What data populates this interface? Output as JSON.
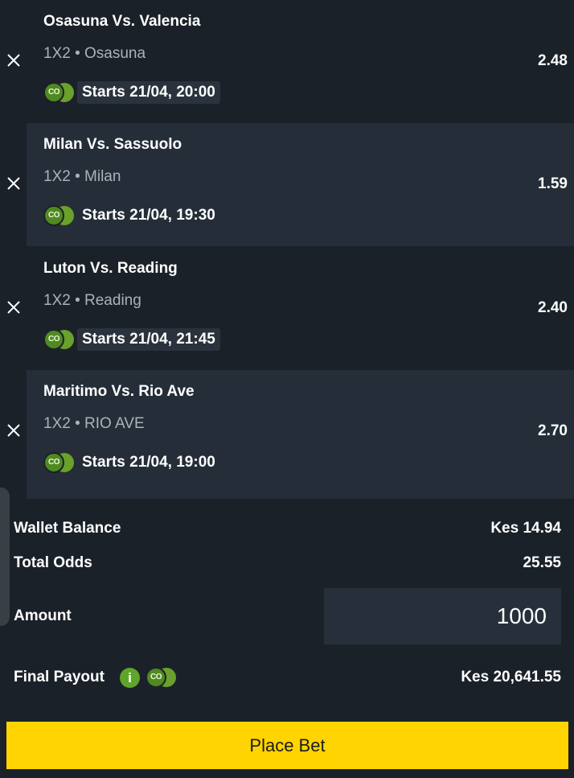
{
  "bets": [
    {
      "match": "Osasuna Vs. Valencia",
      "market": "1X2 • Osasuna",
      "odds": "2.48",
      "starts": "Starts 21/04, 20:00"
    },
    {
      "match": "Milan Vs. Sassuolo",
      "market": "1X2 • Milan",
      "odds": "1.59",
      "starts": "Starts 21/04, 19:30"
    },
    {
      "match": "Luton Vs. Reading",
      "market": "1X2 • Reading",
      "odds": "2.40",
      "starts": "Starts 21/04, 21:45"
    },
    {
      "match": "Maritimo Vs. Rio Ave",
      "market": "1X2 • RIO AVE",
      "odds": "2.70",
      "starts": "Starts 21/04, 19:00"
    }
  ],
  "coin_icon_text": "CO",
  "summary": {
    "wallet_label": "Wallet Balance",
    "wallet_value": "Kes 14.94",
    "odds_label": "Total Odds",
    "odds_value": "25.55",
    "amount_label": "Amount",
    "amount_value": "1000",
    "payout_label": "Final Payout",
    "info_glyph": "i",
    "payout_value": "Kes 20,641.55"
  },
  "place_bet_label": "Place Bet",
  "colors": {
    "accent": "#ffd400",
    "coin": "#4f8a21",
    "background": "#1b2129",
    "panel": "#252e38"
  }
}
